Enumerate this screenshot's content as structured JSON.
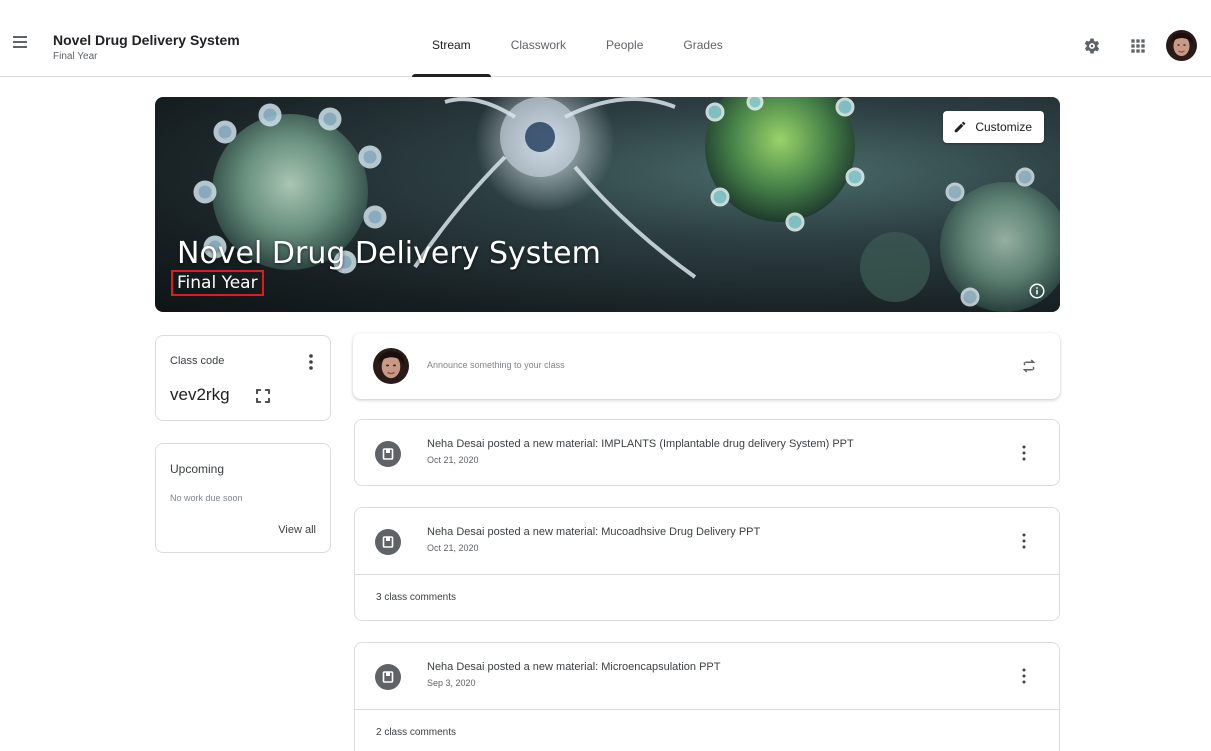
{
  "header": {
    "class_name": "Novel Drug Delivery System",
    "class_section": "Final Year",
    "tabs": [
      {
        "label": "Stream"
      },
      {
        "label": "Classwork"
      },
      {
        "label": "People"
      },
      {
        "label": "Grades"
      }
    ],
    "active_tab": "Stream"
  },
  "banner": {
    "title": "Novel Drug Delivery System",
    "subtitle": "Final Year",
    "customize_label": "Customize"
  },
  "class_code": {
    "label": "Class code",
    "value": "vev2rkg"
  },
  "upcoming": {
    "title": "Upcoming",
    "empty_text": "No work due soon",
    "view_all_label": "View all"
  },
  "announce": {
    "placeholder": "Announce something to your class"
  },
  "posts": [
    {
      "title": "Neha Desai posted a new material: IMPLANTS (Implantable drug delivery System) PPT",
      "date": "Oct 21, 2020",
      "comments": ""
    },
    {
      "title": "Neha Desai posted a new material: Mucoadhsive Drug Delivery PPT",
      "date": "Oct 21, 2020",
      "comments": "3 class comments"
    },
    {
      "title": "Neha Desai posted a new material: Microencapsulation PPT",
      "date": "Sep 3, 2020",
      "comments": "2 class comments"
    }
  ],
  "colors": {
    "highlight_box": "#e01b1b",
    "text_primary": "#202124",
    "text_secondary": "#5f6368",
    "divider": "#dadce0"
  },
  "icons": [
    "menu-icon",
    "gear-icon",
    "apps-icon",
    "edit-icon",
    "info-icon",
    "more-vert-icon",
    "fullscreen-icon",
    "repost-icon",
    "material-icon"
  ]
}
